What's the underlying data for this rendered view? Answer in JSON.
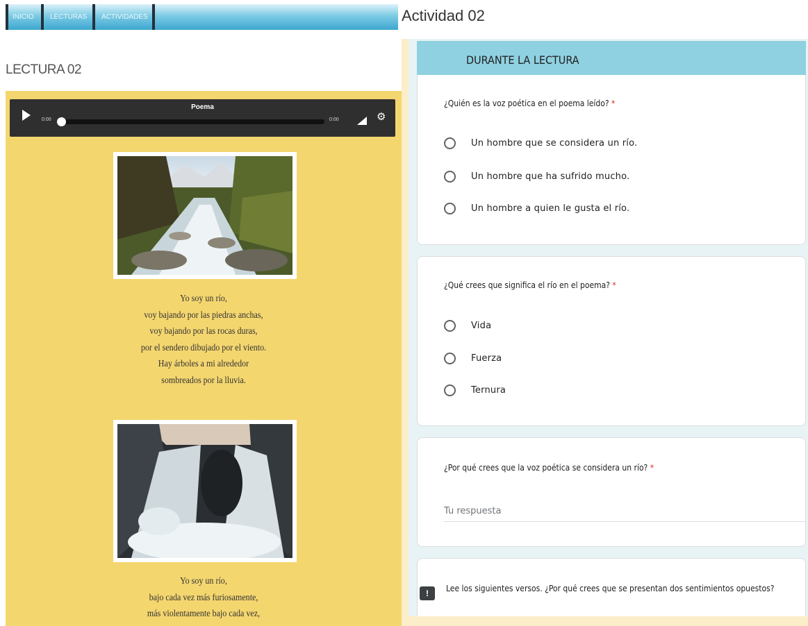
{
  "nav": {
    "items": [
      "INICIO",
      "LECTURAS",
      "ACTIVIDADES"
    ]
  },
  "lectura": {
    "title": "LECTURA 02",
    "player": {
      "title": "Poema",
      "current_time": "0:00",
      "duration": "0:00",
      "progress": 0
    },
    "verses1": [
      "Yo soy un río,",
      "voy bajando por las piedras anchas,",
      "voy bajando por las rocas duras,",
      "por el sendero dibujado por el viento.",
      "Hay árboles a mi alrededor",
      "sombreados por la lluvia."
    ],
    "verses2": [
      "Yo soy un río,",
      "bajo cada vez más furiosamente,",
      "más violentamente bajo cada vez,"
    ]
  },
  "actividad": {
    "title": "Actividad 02",
    "section": "DURANTE LA LECTURA",
    "required_mark": "*",
    "q1": {
      "text": "¿Quién es la voz poética en el poema leído?",
      "options": [
        "Un hombre que se considera un río.",
        "Un hombre que ha sufrido mucho.",
        "Un hombre a quien le gusta el río."
      ]
    },
    "q2": {
      "text": "¿Qué crees que significa el río en el poema?",
      "options": [
        "Vida",
        "Fuerza",
        "Ternura"
      ]
    },
    "q3": {
      "text": "¿Por qué crees que la voz poética se considera un río?",
      "placeholder": "Tu respuesta"
    },
    "q4": {
      "text": "Lee los siguientes versos. ¿Por qué crees que se presentan dos sentimientos opuestos?",
      "icon_glyph": "!"
    }
  },
  "colors": {
    "reading_bg": "#f4d66f",
    "section_head": "#8fd1e0",
    "form_bg": "#fbeec9",
    "required": "#d93025"
  },
  "icons": [
    "play-icon",
    "volume-icon",
    "gear-icon",
    "feedback-icon"
  ]
}
